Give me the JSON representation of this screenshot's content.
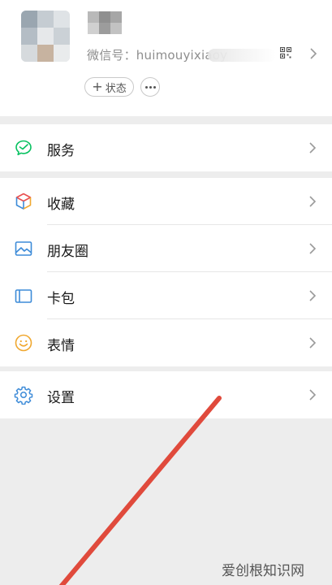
{
  "profile": {
    "id_text": "微信号：huimouyixiaoy",
    "status_label": "状态",
    "plus_glyph": "+"
  },
  "menu": {
    "services": {
      "label": "服务",
      "icon": "services-icon",
      "color": "#07c160"
    },
    "favorites": {
      "label": "收藏",
      "icon": "favorites-cube-icon"
    },
    "moments": {
      "label": "朋友圈",
      "icon": "moments-photo-icon",
      "color": "#3d8bd8"
    },
    "cards": {
      "label": "卡包",
      "icon": "cards-wallet-icon",
      "color": "#3d8bd8"
    },
    "stickers": {
      "label": "表情",
      "icon": "stickers-smile-icon",
      "color": "#f0a830"
    },
    "settings": {
      "label": "设置",
      "icon": "settings-gear-icon",
      "color": "#3d8bd8"
    }
  },
  "watermark": {
    "text": "爱创根知识网"
  },
  "annotation": {
    "color": "#e04a3c"
  }
}
